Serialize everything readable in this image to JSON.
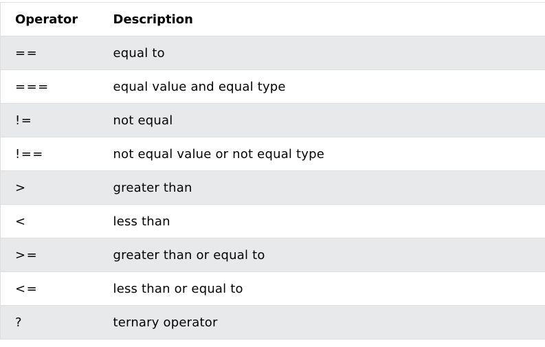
{
  "table": {
    "headers": [
      "Operator",
      "Description"
    ],
    "rows": [
      {
        "operator": "==",
        "description": "equal to"
      },
      {
        "operator": "===",
        "description": "equal value and equal type"
      },
      {
        "operator": "!=",
        "description": "not equal"
      },
      {
        "operator": "!==",
        "description": "not equal value or not equal type"
      },
      {
        "operator": ">",
        "description": "greater than"
      },
      {
        "operator": "<",
        "description": "less than"
      },
      {
        "operator": ">=",
        "description": "greater than or equal to"
      },
      {
        "operator": "<=",
        "description": "less than or equal to"
      },
      {
        "operator": "?",
        "description": "ternary operator"
      }
    ]
  }
}
